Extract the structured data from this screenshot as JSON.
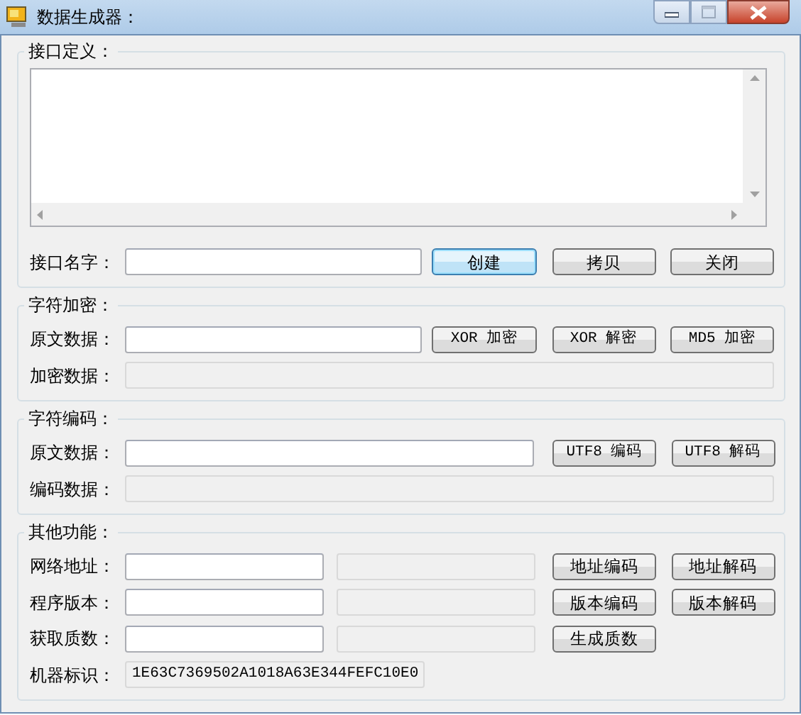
{
  "window": {
    "title": "数据生成器："
  },
  "sections": [
    {
      "title": "接口定义：",
      "kind": "editor",
      "rows": [
        {
          "kind": "input3",
          "label": "接口名字：",
          "buttons": [
            {
              "label": "创建",
              "focused": true
            },
            {
              "label": "拷贝",
              "focused": false
            },
            {
              "label": "关闭",
              "focused": false
            }
          ]
        }
      ]
    },
    {
      "title": "字符加密：",
      "kind": "form",
      "rows": [
        {
          "kind": "input3",
          "label": "原文数据：",
          "buttons": [
            {
              "label": "XOR 加密",
              "focused": false
            },
            {
              "label": "XOR 解密",
              "focused": false
            },
            {
              "label": "MD5 加密",
              "focused": false
            }
          ]
        },
        {
          "kind": "output",
          "label": "加密数据："
        }
      ]
    },
    {
      "title": "字符编码：",
      "kind": "form",
      "rows": [
        {
          "kind": "input2",
          "label": "原文数据：",
          "buttons": [
            {
              "label": "UTF8 编码",
              "focused": false
            },
            {
              "label": "UTF8 解码",
              "focused": false
            }
          ]
        },
        {
          "kind": "output",
          "label": "编码数据："
        }
      ]
    },
    {
      "title": "其他功能：",
      "kind": "form",
      "rows": [
        {
          "kind": "pair",
          "label": "网络地址：",
          "buttons": [
            {
              "label": "地址编码",
              "focused": false
            },
            {
              "label": "地址解码",
              "focused": false
            }
          ]
        },
        {
          "kind": "pair",
          "label": "程序版本：",
          "buttons": [
            {
              "label": "版本编码",
              "focused": false
            },
            {
              "label": "版本解码",
              "focused": false
            }
          ]
        },
        {
          "kind": "pair",
          "label": "获取质数：",
          "buttons": [
            {
              "label": "生成质数",
              "focused": false
            }
          ]
        },
        {
          "kind": "id",
          "label": "机器标识：",
          "value": "1E63C7369502A1018A63E344FEFC10E0"
        }
      ]
    }
  ]
}
